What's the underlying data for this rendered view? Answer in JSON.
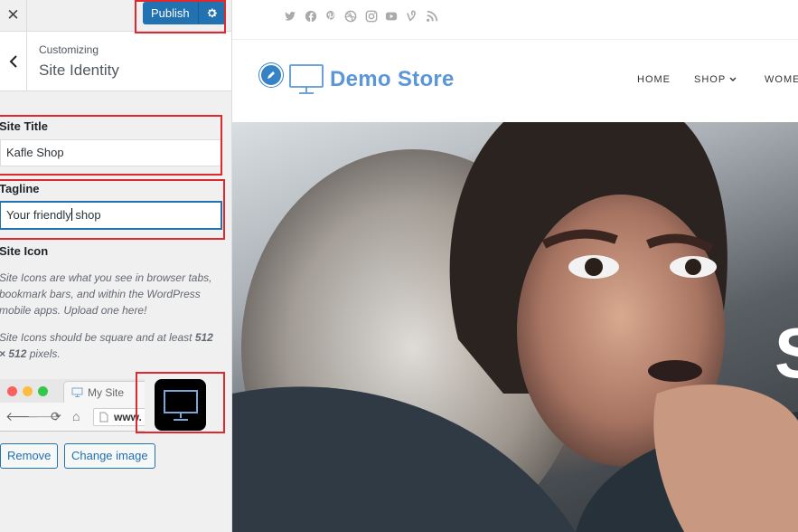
{
  "customizer": {
    "close_glyph": "✕",
    "publish_label": "Publish",
    "publish_settings_icon": "gear-icon",
    "back_icon": "chevron-left-icon",
    "customizing_label": "Customizing",
    "section_title": "Site Identity",
    "site_title": {
      "label": "Site Title",
      "value": "Kafle Shop"
    },
    "tagline": {
      "label": "Tagline",
      "value_before_caret": "Your friendly",
      "value_after_caret": " shop"
    },
    "site_icon": {
      "label": "Site Icon",
      "description_1": "Site Icons are what you see in browser tabs, bookmark bars, and within the WordPress mobile apps. Upload one here!",
      "description_2_before": "Site Icons should be square and at least ",
      "description_2_size": "512 × 512",
      "description_2_after": " pixels.",
      "browser_tab_label": "My Site",
      "browser_url": "www.",
      "remove_label": "Remove",
      "change_label": "Change image"
    },
    "colors": {
      "accent": "#2271b1",
      "highlight_box": "#e0282e"
    }
  },
  "preview": {
    "social_icons": [
      "twitter-icon",
      "facebook-icon",
      "pinterest-icon",
      "dribbble-icon",
      "instagram-icon",
      "youtube-icon",
      "vine-icon",
      "rss-icon"
    ],
    "store_name": "Demo Store",
    "nav": {
      "home": "HOME",
      "shop": "SHOP",
      "women": "WOME"
    },
    "hero_text": "S",
    "colors": {
      "brand": "#5a96d8"
    }
  }
}
